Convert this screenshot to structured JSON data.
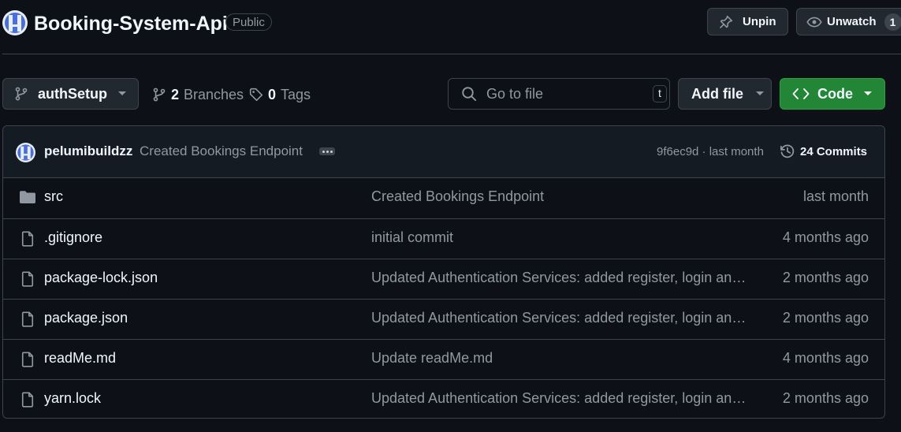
{
  "repo": {
    "name": "Booking-System-Api",
    "visibility": "Public",
    "unpin_label": "Unpin",
    "unwatch_label": "Unwatch",
    "watch_count": "1"
  },
  "toolbar": {
    "branch": "authSetup",
    "branches_count": "2",
    "branches_label": "Branches",
    "tags_count": "0",
    "tags_label": "Tags",
    "search_placeholder": "Go to file",
    "search_shortcut": "t",
    "add_file_label": "Add file",
    "code_label": "Code",
    "code_color": "#238636"
  },
  "latest_commit": {
    "author": "pelumibuildzz",
    "message": "Created Bookings Endpoint",
    "sha_time": "9f6ec9d · last month",
    "commits_label": "24 Commits"
  },
  "files": [
    {
      "name": "src",
      "type": "folder",
      "commit": "Created Bookings Endpoint",
      "time": "last month"
    },
    {
      "name": ".gitignore",
      "type": "file",
      "commit": "initial commit",
      "time": "4 months ago"
    },
    {
      "name": "package-lock.json",
      "type": "file",
      "commit": "Updated Authentication Services: added register, login and …",
      "time": "2 months ago"
    },
    {
      "name": "package.json",
      "type": "file",
      "commit": "Updated Authentication Services: added register, login and …",
      "time": "2 months ago"
    },
    {
      "name": "readMe.md",
      "type": "file",
      "commit": "Update readMe.md",
      "time": "4 months ago"
    },
    {
      "name": "yarn.lock",
      "type": "file",
      "commit": "Updated Authentication Services: added register, login and …",
      "time": "2 months ago"
    }
  ]
}
